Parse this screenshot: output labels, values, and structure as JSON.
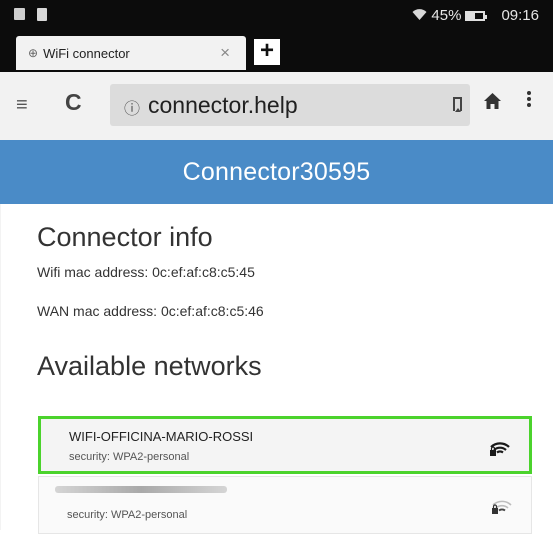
{
  "status_bar": {
    "battery": "45%",
    "time": "09:16"
  },
  "tab": {
    "title": "WiFi connector",
    "close": "×",
    "new_tab": "+"
  },
  "url_bar": {
    "url": "connector.help"
  },
  "header": {
    "title": "Connector30595"
  },
  "connector_info": {
    "heading": "Connector info",
    "wifi_mac": "Wifi mac address: 0c:ef:af:c8:c5:45",
    "wan_mac": "WAN mac address: 0c:ef:af:c8:c5:46"
  },
  "networks": {
    "heading": "Available networks",
    "items": [
      {
        "name": "WIFI-OFFICINA-MARIO-ROSSI",
        "security": "security: WPA2-personal",
        "signal": 1.0,
        "selected": true
      },
      {
        "name": "",
        "security": "security: WPA2-personal",
        "signal": 0.4,
        "selected": false
      }
    ]
  },
  "colors": {
    "header": "#4a8bc7",
    "selected_border": "#4bd32c"
  }
}
